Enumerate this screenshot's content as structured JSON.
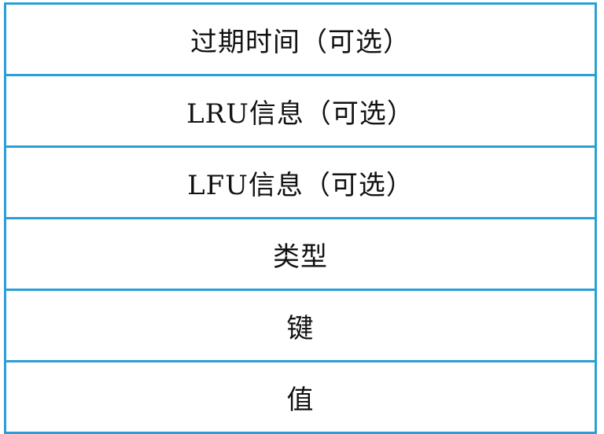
{
  "diagram": {
    "border_color": "#2a9fd6",
    "fields": [
      "过期时间（可选）",
      "LRU信息（可选）",
      "LFU信息（可选）",
      "类型",
      "键",
      "值"
    ]
  }
}
